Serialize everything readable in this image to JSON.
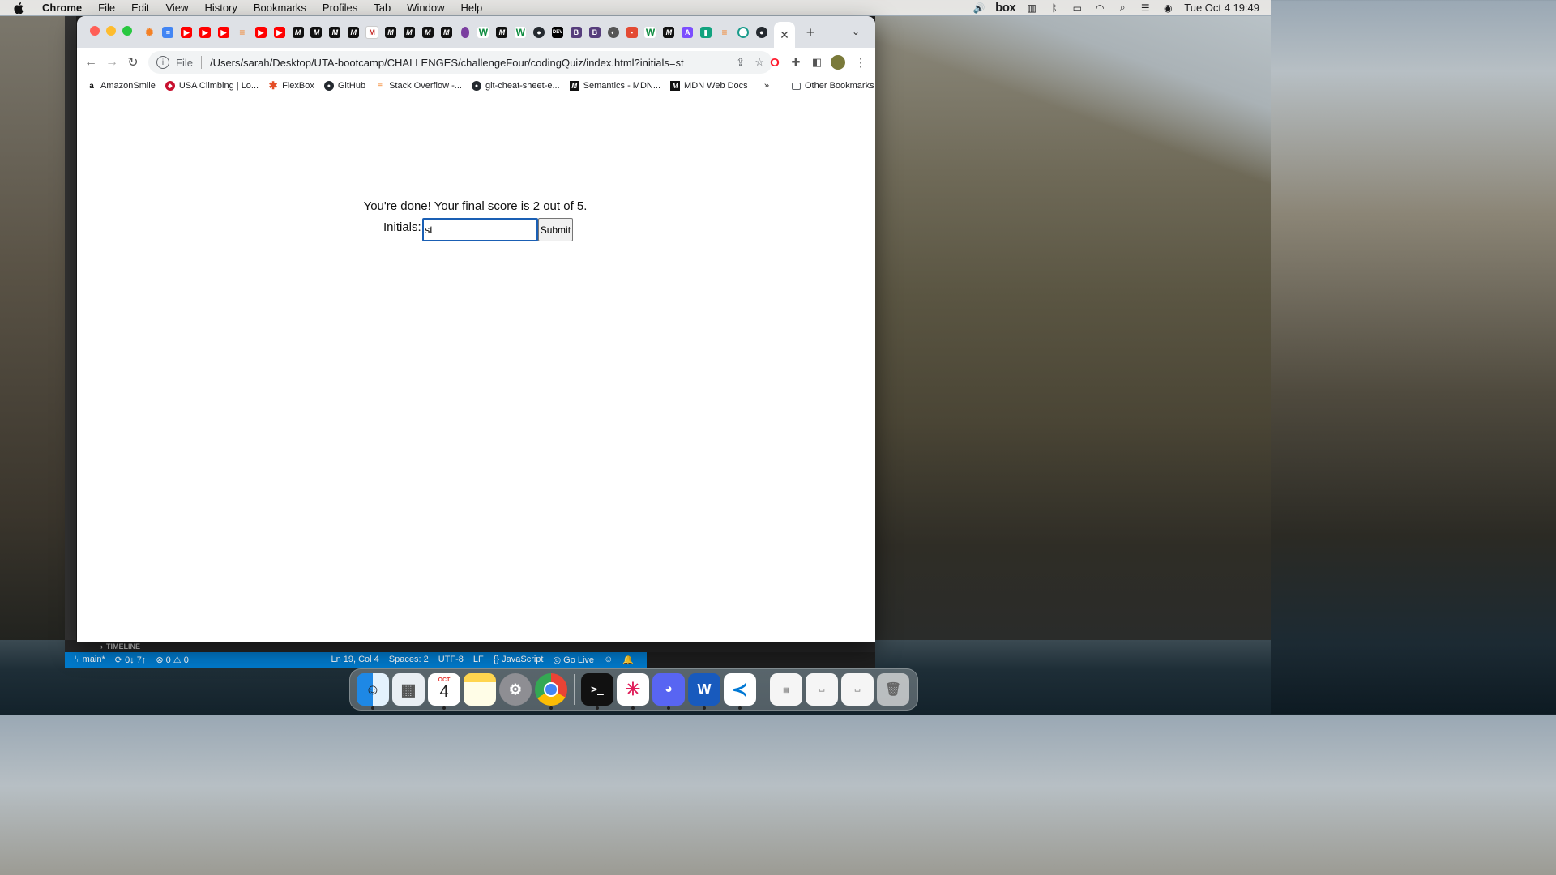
{
  "menubar": {
    "app": "Chrome",
    "items": [
      "File",
      "Edit",
      "View",
      "History",
      "Bookmarks",
      "Profiles",
      "Tab",
      "Window",
      "Help"
    ],
    "box_label": "box",
    "datetime": "Tue Oct 4  19:49"
  },
  "browser": {
    "url_scheme": "File",
    "url": "/Users/sarah/Desktop/UTA-bootcamp/CHALLENGES/challengeFour/codingQuiz/index.html?initials=st",
    "tab_favicons": [
      "sparkle",
      "gdoc",
      "yt",
      "yt",
      "yt",
      "so",
      "yt",
      "yt",
      "mdn",
      "mdn",
      "mdn",
      "mdn",
      "gmail",
      "mdn",
      "mdn",
      "mdn",
      "mdn",
      "onion",
      "w",
      "mdn",
      "w",
      "github",
      "dev",
      "bs",
      "bs",
      "globe",
      "pdf",
      "w",
      "mdn",
      "ai",
      "teal",
      "so",
      "clock",
      "github",
      "mdn"
    ],
    "bookmarks": [
      {
        "label": "AmazonSmile",
        "icon": "amazon-icon"
      },
      {
        "label": "USA Climbing | Lo...",
        "icon": "usa-climbing-icon"
      },
      {
        "label": "FlexBox",
        "icon": "flexbox-icon"
      },
      {
        "label": "GitHub",
        "icon": "github-icon"
      },
      {
        "label": "Stack Overflow -...",
        "icon": "stackoverflow-icon"
      },
      {
        "label": "git-cheat-sheet-e...",
        "icon": "github-icon"
      },
      {
        "label": "Semantics - MDN...",
        "icon": "mdn-icon"
      },
      {
        "label": "MDN Web Docs",
        "icon": "mdn-icon"
      }
    ],
    "more_bookmarks": "»",
    "other_bookmarks": "Other Bookmarks"
  },
  "page": {
    "done_message": "You're done! Your final score is 2 out of 5.",
    "initials_label": "Initials:",
    "initials_value": "st",
    "submit_label": "Submit"
  },
  "vscode": {
    "timeline": "TIMELINE",
    "branch": "main*",
    "sync": "0↓ 7↑",
    "problems": "⊗ 0 ⚠ 0",
    "cursor": "Ln 19, Col 4",
    "spaces": "Spaces: 2",
    "encoding": "UTF-8",
    "eol": "LF",
    "language": "JavaScript",
    "golive": "Go Live"
  },
  "dock": {
    "calendar_month": "OCT",
    "calendar_day": "4"
  }
}
